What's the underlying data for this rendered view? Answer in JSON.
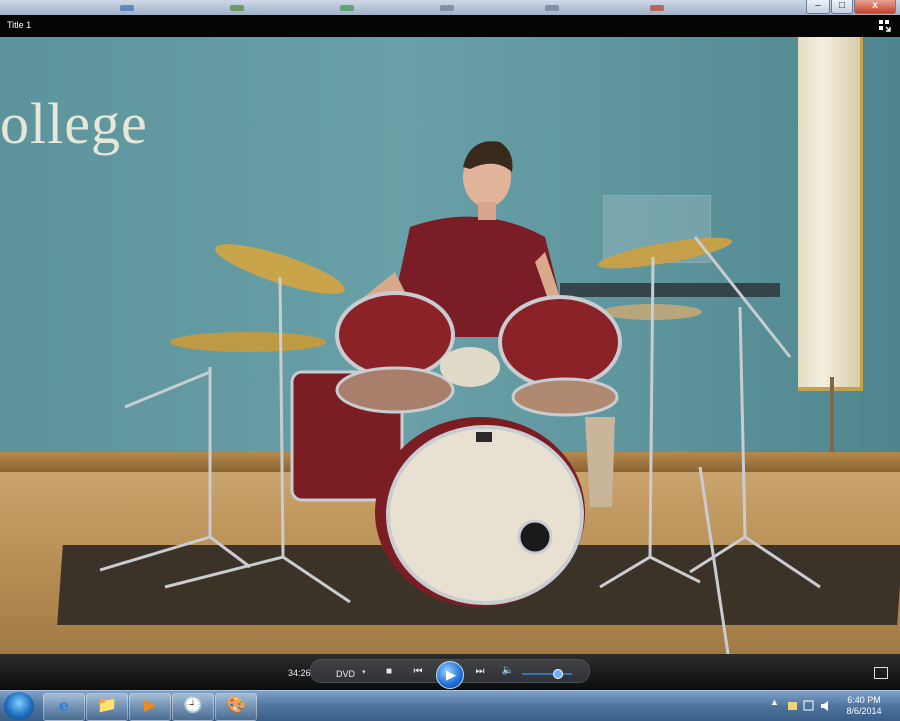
{
  "window": {
    "title": "Title 1",
    "controls": {
      "minimize": "–",
      "maximize": "□",
      "close": "x"
    }
  },
  "video": {
    "backdrop_text": "ollege"
  },
  "player": {
    "elapsed_time": "34:26",
    "source_label": "DVD",
    "source_dropdown": "▾",
    "stop_glyph": "■",
    "prev_glyph": "⏮",
    "play_glyph": "▶",
    "next_glyph": "⏭",
    "volume_glyph": "🔈",
    "volume_level": 0.7
  },
  "taskbar": {
    "pinned": [
      {
        "name": "internet-explorer",
        "glyph": "e"
      },
      {
        "name": "file-explorer",
        "glyph": "📁"
      },
      {
        "name": "media-player",
        "glyph": "▶"
      },
      {
        "name": "clock-app",
        "glyph": "🕘"
      },
      {
        "name": "paint-app",
        "glyph": "🎨"
      }
    ],
    "tray_arrow": "▲",
    "clock_time": "6:40 PM",
    "clock_date": "8/6/2014"
  }
}
